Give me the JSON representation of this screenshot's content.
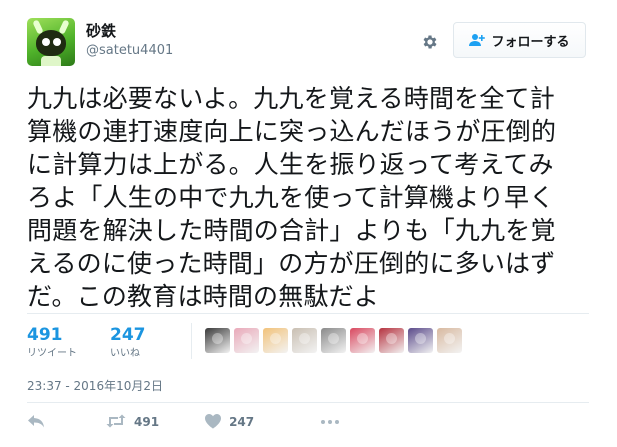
{
  "user": {
    "display_name": "砂鉄",
    "handle": "@satetu4401"
  },
  "header": {
    "follow_label": "フォローする",
    "settings_icon": "gear-icon",
    "follow_icon": "person-plus-icon"
  },
  "tweet": {
    "text": "九九は必要ないよ。九九を覚える時間を全て計\n算機の連打速度向上に突っ込んだほうが圧倒的\nに計算力は上がる。人生を振り返って考えてみ\nろよ「人生の中で九九を使って計算機より早く\n問題を解決した時間の合計」よりも「九九を覚\nえるのに使った時間」の方が圧倒的に多いはず\nだ。この教育は時間の無駄だよ",
    "timestamp": "23:37 - 2016年10月2日"
  },
  "stats": {
    "retweets": {
      "count": "491",
      "label": "リツイート"
    },
    "likes": {
      "count": "247",
      "label": "いいね"
    }
  },
  "likers": {
    "count": 9,
    "colors": [
      "#3a3a3a",
      "#e9a9b9",
      "#f2c27a",
      "#c9bfb2",
      "#8a8a8a",
      "#d9485f",
      "#b5323f",
      "#5a4a8a",
      "#d8b9a0"
    ]
  },
  "actions": {
    "reply_icon": "reply-icon",
    "retweet_icon": "retweet-icon",
    "retweet_count": "491",
    "like_icon": "heart-icon",
    "like_count": "247",
    "more_icon": "more-dots-icon"
  },
  "colors": {
    "accent": "#1da1f2",
    "stat_number": "#1b95e0",
    "muted": "#657786",
    "icon_muted": "#aab8c2"
  }
}
